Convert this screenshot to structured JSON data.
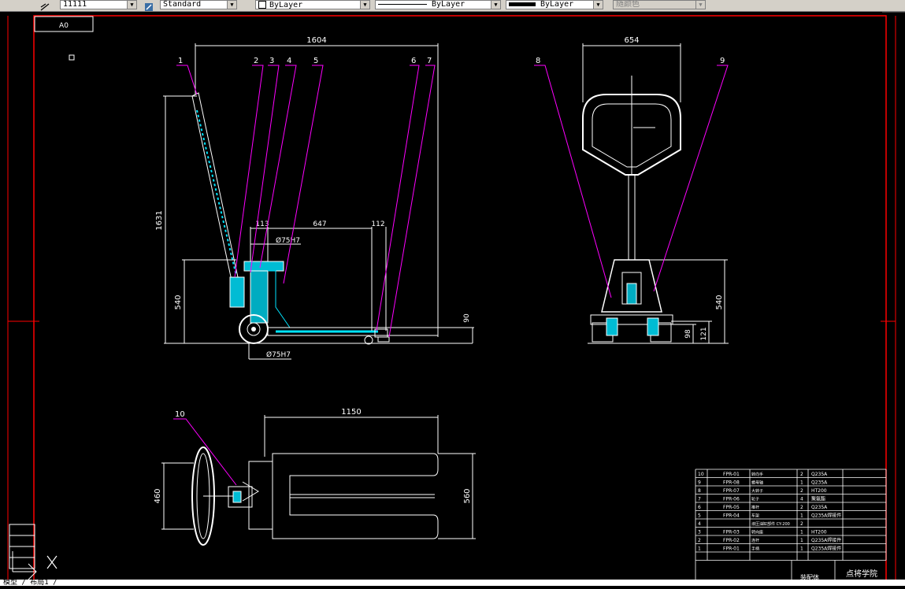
{
  "toolbar": {
    "linetype_scale": "11111",
    "text_style": "Standard",
    "layer_color": "ByLayer",
    "linetype": "ByLayer",
    "lineweight": "ByLayer",
    "plot_style": "随颜色"
  },
  "sheet": {
    "size_label": "A0"
  },
  "dimensions": {
    "total_length": "1604",
    "height": "1631",
    "mast_height": "540",
    "d1": "113",
    "d2": "647",
    "d3": "112",
    "bore_top": "Ø75H7",
    "bore_bottom": "Ø75H7",
    "fork_height": "90",
    "front_width": "654",
    "front_height": "540",
    "wheel_h1": "98",
    "wheel_h2": "121",
    "fork_length": "1150",
    "handle_width": "460",
    "fork_width": "560"
  },
  "callouts": [
    "1",
    "2",
    "3",
    "4",
    "5",
    "6",
    "7",
    "8",
    "9",
    "10"
  ],
  "bom": {
    "rows": [
      {
        "no": "10",
        "code": "FPR-01",
        "name": "转向手",
        "qty": "2",
        "material": "Q235A"
      },
      {
        "no": "9",
        "code": "FPR-08",
        "name": "螺母轴",
        "qty": "1",
        "material": "Q235A"
      },
      {
        "no": "8",
        "code": "FPR-07",
        "name": "大转子",
        "qty": "2",
        "material": "HT200"
      },
      {
        "no": "7",
        "code": "FPR-06",
        "name": "轮子",
        "qty": "4",
        "material": "聚氨酯"
      },
      {
        "no": "6",
        "code": "FPR-05",
        "name": "推杆",
        "qty": "2",
        "material": "Q235A"
      },
      {
        "no": "5",
        "code": "FPR-04",
        "name": "车架",
        "qty": "1",
        "material": "Q235A焊接件"
      },
      {
        "no": "4",
        "code": "",
        "name": "液压油缸部件 CY-200",
        "qty": "2",
        "material": ""
      },
      {
        "no": "3",
        "code": "FPR-03",
        "name": "转向座",
        "qty": "1",
        "material": "HT200"
      },
      {
        "no": "2",
        "code": "FPR-02",
        "name": "连杆",
        "qty": "1",
        "material": "Q235A焊接件"
      },
      {
        "no": "1",
        "code": "FPR-01",
        "name": "手柄",
        "qty": "1",
        "material": "Q235A焊接件"
      }
    ],
    "footer_left": "装配体",
    "footer_right": "点将学院"
  },
  "command_line": "模型 / 布局1 /",
  "colors": {
    "dimension": "#ffffff",
    "outline": "#ffffff",
    "hatch": "#00e5ff",
    "leader": "#ff00ff",
    "border": "#ff0000"
  }
}
